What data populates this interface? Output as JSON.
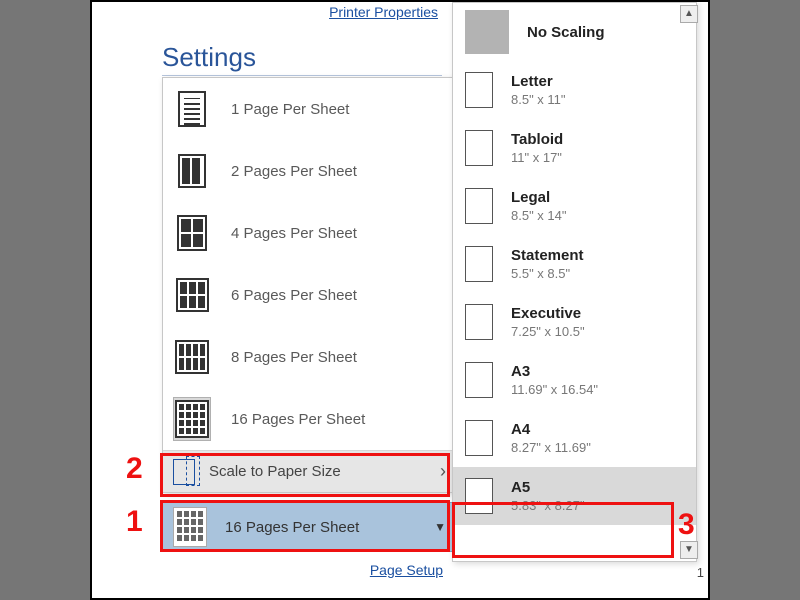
{
  "header": {
    "printer_properties": "Printer Properties",
    "settings_title": "Settings",
    "page_setup": "Page Setup",
    "page_count": "1"
  },
  "pages_menu": [
    {
      "label": "1 Page Per Sheet"
    },
    {
      "label": "2 Pages Per Sheet"
    },
    {
      "label": "4 Pages Per Sheet"
    },
    {
      "label": "6 Pages Per Sheet"
    },
    {
      "label": "8 Pages Per Sheet"
    },
    {
      "label": "16 Pages Per Sheet"
    }
  ],
  "scale_row": {
    "label": "Scale to Paper Size"
  },
  "current_selection": {
    "label": "16 Pages Per Sheet"
  },
  "paper_menu": [
    {
      "name": "No Scaling",
      "dim": ""
    },
    {
      "name": "Letter",
      "dim": "8.5\" x 11\""
    },
    {
      "name": "Tabloid",
      "dim": "11\" x 17\""
    },
    {
      "name": "Legal",
      "dim": "8.5\" x 14\""
    },
    {
      "name": "Statement",
      "dim": "5.5\" x 8.5\""
    },
    {
      "name": "Executive",
      "dim": "7.25\" x 10.5\""
    },
    {
      "name": "A3",
      "dim": "11.69\" x 16.54\""
    },
    {
      "name": "A4",
      "dim": "8.27\" x 11.69\""
    },
    {
      "name": "A5",
      "dim": "5.83\" x 8.27\""
    }
  ],
  "annotations": {
    "n1": "1",
    "n2": "2",
    "n3": "3"
  }
}
